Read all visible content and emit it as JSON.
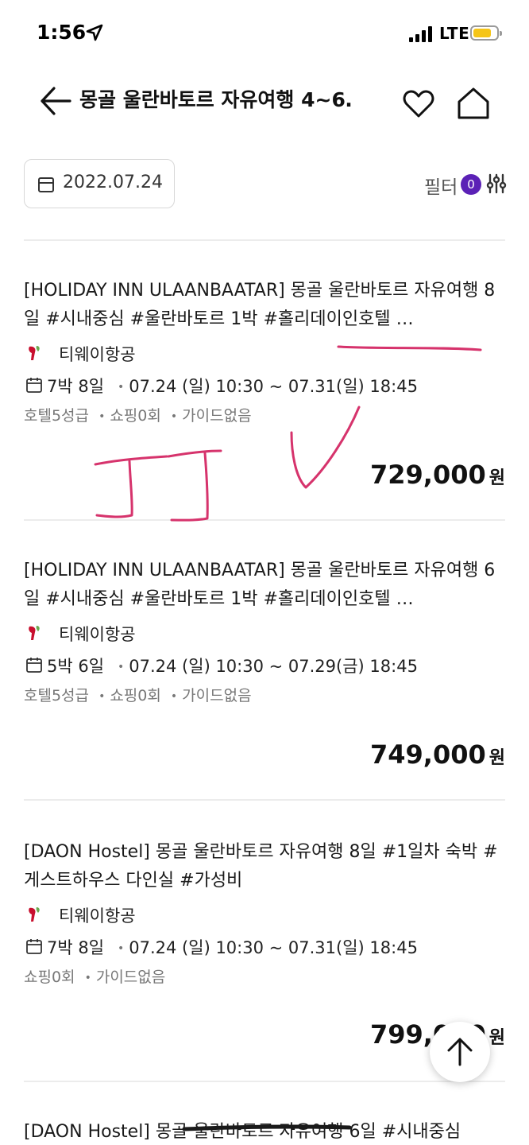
{
  "status_bar": {
    "time": "1:56",
    "network": "LTE"
  },
  "header": {
    "title": "몽골 울란바토르 자유여행 4~6…"
  },
  "toolbar": {
    "date": "2022.07.24",
    "filter_label": "필터",
    "filter_count": "0"
  },
  "products": [
    {
      "title": "[HOLIDAY INN ULAANBAATAR] 몽골 울란바토르 자유여행 8일 #시내중심 #울란바토르 1박 #홀리데이인호텔 …",
      "airline": "티웨이항공",
      "nights": "7박 8일",
      "schedule": "07.24 (일) 10:30 ~ 07.31(일) 18:45",
      "tags": [
        "호텔5성급",
        "쇼핑0회",
        "가이드없음"
      ],
      "price": "729,000",
      "currency": "원"
    },
    {
      "title": "[HOLIDAY INN ULAANBAATAR] 몽골 울란바토르 자유여행 6일 #시내중심 #울란바토르 1박 #홀리데이인호텔 …",
      "airline": "티웨이항공",
      "nights": "5박 6일",
      "schedule": "07.24 (일) 10:30 ~ 07.29(금) 18:45",
      "tags": [
        "호텔5성급",
        "쇼핑0회",
        "가이드없음"
      ],
      "price": "749,000",
      "currency": "원"
    },
    {
      "title": "[DAON Hostel] 몽골 울란바토르 자유여행 8일 #1일차 숙박 #게스트하우스 다인실 #가성비",
      "airline": "티웨이항공",
      "nights": "7박 8일",
      "schedule": "07.24 (일) 10:30 ~ 07.31(일) 18:45",
      "tags": [
        "쇼핑0회",
        "가이드없음"
      ],
      "price": "799,000",
      "currency": "원"
    },
    {
      "title": "[DAON Hostel] 몽골 울란바토르 자유여행 6일 #시내중심"
    }
  ],
  "colors": {
    "accent": "#5b21b6",
    "annotation_ink": "#d6336c",
    "airline_logo_red": "#c8102e",
    "airline_logo_green": "#6aa84f"
  }
}
